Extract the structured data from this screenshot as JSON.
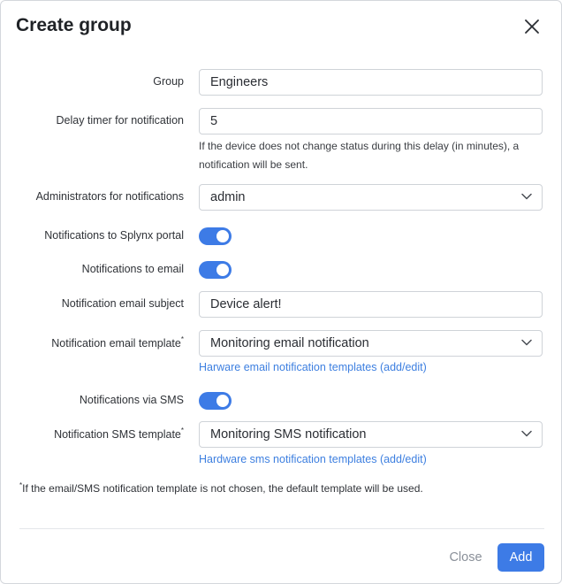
{
  "dialog": {
    "title": "Create group"
  },
  "form": {
    "group": {
      "label": "Group",
      "value": "Engineers"
    },
    "delay": {
      "label": "Delay timer for notification",
      "value": "5",
      "help": "If the device does not change status during this delay (in minutes), a notification will be sent."
    },
    "administrators": {
      "label": "Administrators for notifications",
      "value": "admin"
    },
    "portal": {
      "label": "Notifications to Splynx portal",
      "enabled": true
    },
    "email": {
      "label": "Notifications to email",
      "enabled": true
    },
    "email_subject": {
      "label": "Notification email subject",
      "value": "Device alert!"
    },
    "email_template": {
      "label": "Notification email template",
      "required_mark": "*",
      "value": "Monitoring email notification",
      "link": "Harware email notification templates (add/edit)"
    },
    "sms": {
      "label": "Notifications via SMS",
      "enabled": true
    },
    "sms_template": {
      "label": "Notification SMS template",
      "required_mark": "*",
      "value": "Monitoring SMS notification",
      "link": "Hardware sms notification templates (add/edit)"
    }
  },
  "footnote": {
    "mark": "*",
    "text": "If the email/SMS notification template is not chosen, the default template will be used."
  },
  "footer": {
    "close_label": "Close",
    "add_label": "Add"
  },
  "colors": {
    "accent": "#3d7be6",
    "link": "#3d7fe0"
  }
}
